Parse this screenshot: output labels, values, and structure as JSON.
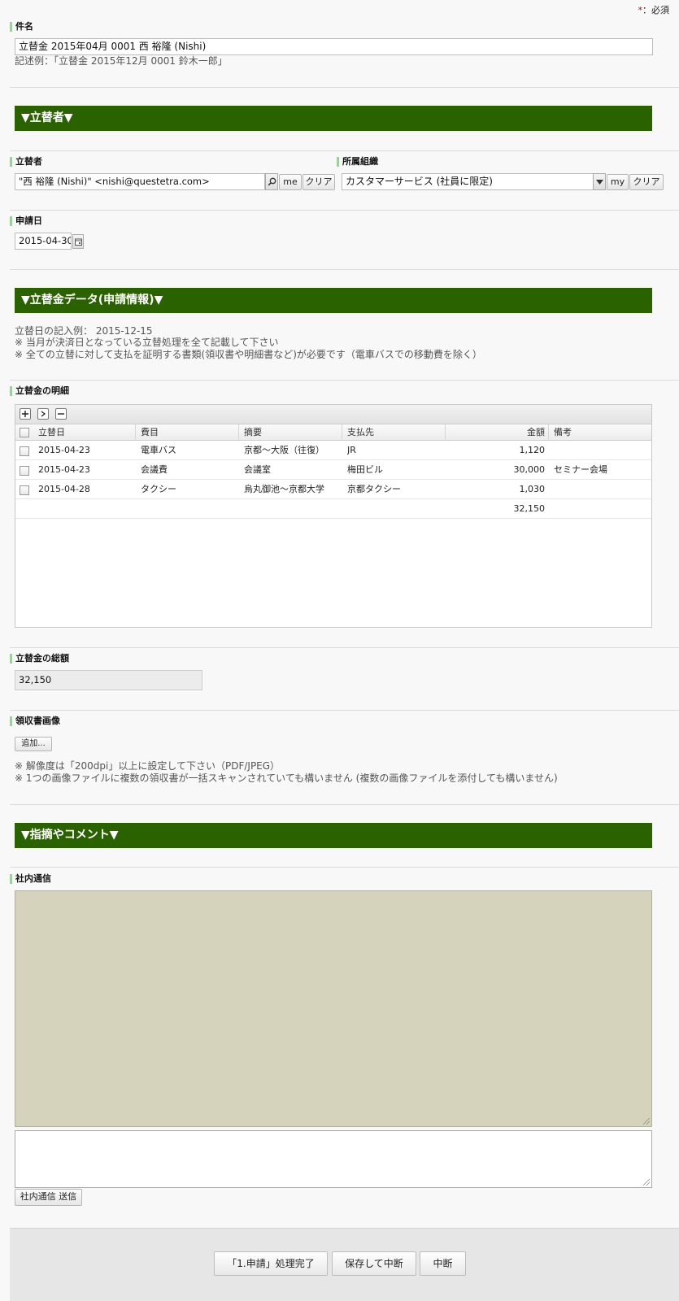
{
  "required_note": {
    "star": "*",
    "text": "：必須"
  },
  "subject": {
    "label": "件名",
    "value": "立替金 2015年04月 0001 西 裕隆 (Nishi)",
    "example": "記述例：「立替金 2015年12月 0001 鈴木一郎」"
  },
  "section_payer": "▼立替者▼",
  "payer": {
    "label": "立替者",
    "value": "\"西 裕隆 (Nishi)\" <nishi@questetra.com>",
    "search_icon": "search-icon",
    "me_label": "me",
    "clear_label": "クリア"
  },
  "org": {
    "label": "所属組織",
    "value": "カスタマーサービス (社員に限定)",
    "my_label": "my",
    "clear_label": "クリア"
  },
  "apply_date": {
    "label": "申請日",
    "value": "2015-04-30",
    "calendar_icon": "calendar-icon"
  },
  "section_data": "▼立替金データ(申請情報)▼",
  "notes": [
    "立替日の記入例： 2015-12-15",
    "※ 当月が決済日となっている立替処理を全て記載して下さい",
    "※ 全ての立替に対して支払を証明する書類(領収書や明細書など)が必要です（電車バスでの移動費を除く）"
  ],
  "details": {
    "label": "立替金の明細",
    "columns": [
      "立替日",
      "費目",
      "摘要",
      "支払先",
      "金額",
      "備考"
    ],
    "rows": [
      {
        "date": "2015-04-23",
        "category": "電車バス",
        "summary": "京都～大阪（往復）",
        "payee": "JR",
        "amount": "1,120",
        "remark": ""
      },
      {
        "date": "2015-04-23",
        "category": "会議費",
        "summary": "会議室",
        "payee": "梅田ビル",
        "amount": "30,000",
        "remark": "セミナー会場"
      },
      {
        "date": "2015-04-28",
        "category": "タクシー",
        "summary": "烏丸御池～京都大学",
        "payee": "京都タクシー",
        "amount": "1,030",
        "remark": ""
      }
    ],
    "total": "32,150"
  },
  "total_amount": {
    "label": "立替金の総額",
    "value": "32,150"
  },
  "receipt": {
    "label": "領収書画像",
    "add_label": "追加...",
    "notes": [
      "※ 解像度は「200dpi」以上に設定して下さい（PDF/JPEG）",
      "※ 1つの画像ファイルに複数の領収書が一括スキャンされていても構いません (複数の画像ファイルを添付しても構いません)"
    ]
  },
  "section_comment": "▼指摘やコメント▼",
  "internal": {
    "label": "社内通信",
    "send_label": "社内通信 送信"
  },
  "footer": {
    "complete_label": "「1.申請」処理完了",
    "save_suspend_label": "保存して中断",
    "suspend_label": "中断"
  },
  "colors": {
    "section_bar": "#2b6200",
    "label_accent": "#9fcf9f",
    "comment_area": "#d6d3bd"
  }
}
